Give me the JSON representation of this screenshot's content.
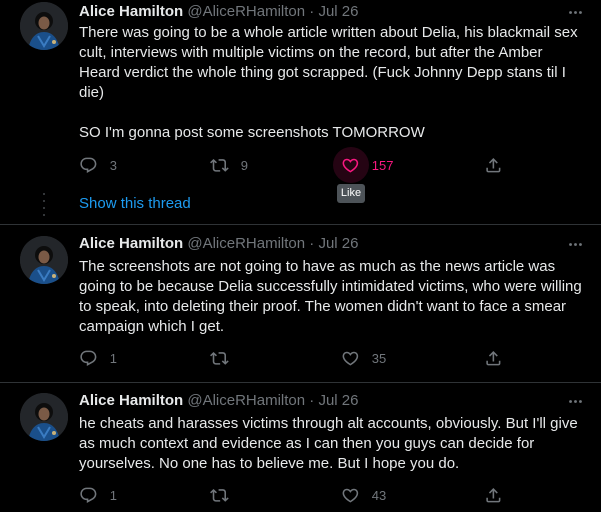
{
  "tweets": [
    {
      "name": "Alice Hamilton",
      "handle": "@AliceRHamilton",
      "dot": "·",
      "date": "Jul 26",
      "text": "There was going to be a whole article written about Delia, his blackmail sex cult, interviews with multiple victims on the record, but after the Amber Heard verdict the whole thing got scrapped. (Fuck Johnny Depp stans til I die)\n\nSO I'm gonna post some screenshots TOMORROW",
      "replies": "3",
      "retweets": "9",
      "likes": "157"
    },
    {
      "name": "Alice Hamilton",
      "handle": "@AliceRHamilton",
      "dot": "·",
      "date": "Jul 26",
      "text": "The screenshots are not going to have as much as the news article was going to be because Delia successfully intimidated victims, who were willing to speak, into deleting their proof. The women didn't want to face a smear campaign which I get.",
      "replies": "1",
      "retweets": "",
      "likes": "35"
    },
    {
      "name": "Alice Hamilton",
      "handle": "@AliceRHamilton",
      "dot": "·",
      "date": "Jul 26",
      "text": "he cheats and harasses victims through alt accounts, obviously. But I'll give as much context and evidence as I can then you guys can decide for yourselves. No one has to believe me. But I hope you do.",
      "replies": "1",
      "retweets": "",
      "likes": "43"
    }
  ],
  "show_thread": "Show this thread",
  "tooltip": "Like",
  "icons": {
    "reply": "reply-icon",
    "retweet": "retweet-icon",
    "like": "heart-icon",
    "share": "share-icon",
    "more": "more-icon"
  },
  "colors": {
    "background": "#000000",
    "text": "#e7e9ea",
    "muted": "#71767b",
    "link": "#1d9bf0",
    "like": "#f91880"
  }
}
